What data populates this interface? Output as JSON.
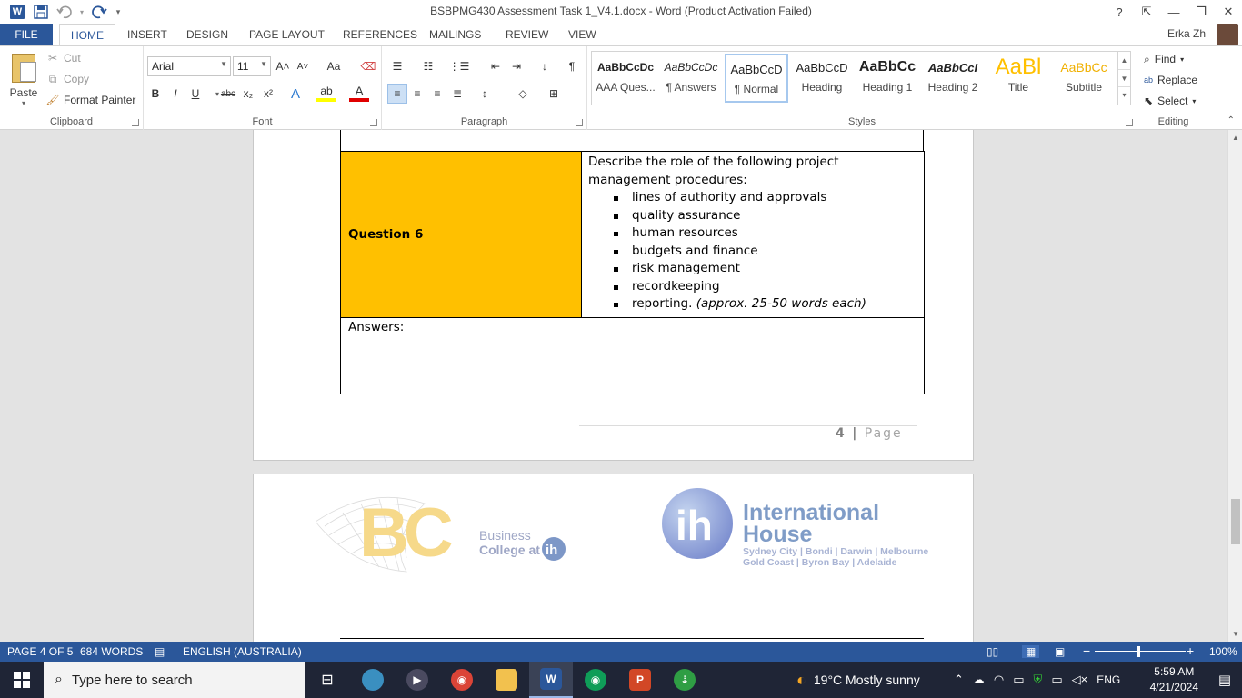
{
  "window": {
    "title": "BSBPMG430 Assessment Task 1_V4.1.docx - Word (Product Activation Failed)",
    "user": "Erka Zh",
    "help": "?",
    "minimize": "—",
    "restore": "❐",
    "close": "✕"
  },
  "tabs": [
    "FILE",
    "HOME",
    "INSERT",
    "DESIGN",
    "PAGE LAYOUT",
    "REFERENCES",
    "MAILINGS",
    "REVIEW",
    "VIEW"
  ],
  "clipboard": {
    "paste": "Paste",
    "cut": "Cut",
    "copy": "Copy",
    "format_painter": "Format Painter",
    "label": "Clipboard"
  },
  "font": {
    "family": "Arial",
    "size": "11",
    "label": "Font",
    "grow": "A˄",
    "shrink": "A˅",
    "case": "Aa",
    "bold": "B",
    "italic": "I",
    "underline": "U",
    "strike": "abc",
    "sub": "x₂",
    "sup": "x²",
    "effects": "A",
    "highlight": "ab",
    "color": "A"
  },
  "paragraph": {
    "label": "Paragraph",
    "pilcrow": "¶"
  },
  "styles": {
    "label": "Styles",
    "items": [
      {
        "sample": "AaBbCcDc",
        "name": "AAA Ques..."
      },
      {
        "sample": "AaBbCcDc",
        "name": "¶ Answers"
      },
      {
        "sample": "AaBbCcD",
        "name": "¶ Normal"
      },
      {
        "sample": "AaBbCcD",
        "name": "Heading"
      },
      {
        "sample": "AaBbCc",
        "name": "Heading 1"
      },
      {
        "sample": "AaBbCcI",
        "name": "Heading 2"
      },
      {
        "sample": "AaBl",
        "name": "Title"
      },
      {
        "sample": "AaBbCc",
        "name": "Subtitle"
      }
    ]
  },
  "editing": {
    "label": "Editing",
    "find": "Find",
    "replace": "Replace",
    "select": "Select"
  },
  "document": {
    "question_label": "Question 6",
    "question_intro": "Describe the role of the following project management procedures:",
    "items": [
      "lines of authority and approvals",
      "quality assurance",
      "human resources",
      "budgets and finance",
      "risk management",
      "recordkeeping"
    ],
    "last_item": "reporting.",
    "last_item_note": "(approx. 25-50 words each)",
    "answers_label": "Answers:",
    "page_number": "4",
    "page_sep": "|",
    "page_word": "Page"
  },
  "logos": {
    "bc_letters": "BC",
    "bc_line1": "Business",
    "bc_line2": "College at",
    "bc_ih": "ih",
    "ih_mark": "ih",
    "ih_line1": "International",
    "ih_line2": "House",
    "ih_cities1": "Sydney City | Bondi | Darwin | Melbourne",
    "ih_cities2": "Gold Coast | Byron Bay | Adelaide"
  },
  "status": {
    "page": "PAGE 4 OF 5",
    "words": "684 WORDS",
    "language": "ENGLISH (AUSTRALIA)",
    "zoom": "100%"
  },
  "taskbar": {
    "search_placeholder": "Type here to search",
    "weather": "19°C  Mostly sunny",
    "lang": "ENG",
    "time": "5:59 AM",
    "date": "4/21/2024"
  },
  "colors": {
    "word_blue": "#2b579a",
    "question_fill": "#ffc000",
    "taskbar": "#1f2536"
  }
}
